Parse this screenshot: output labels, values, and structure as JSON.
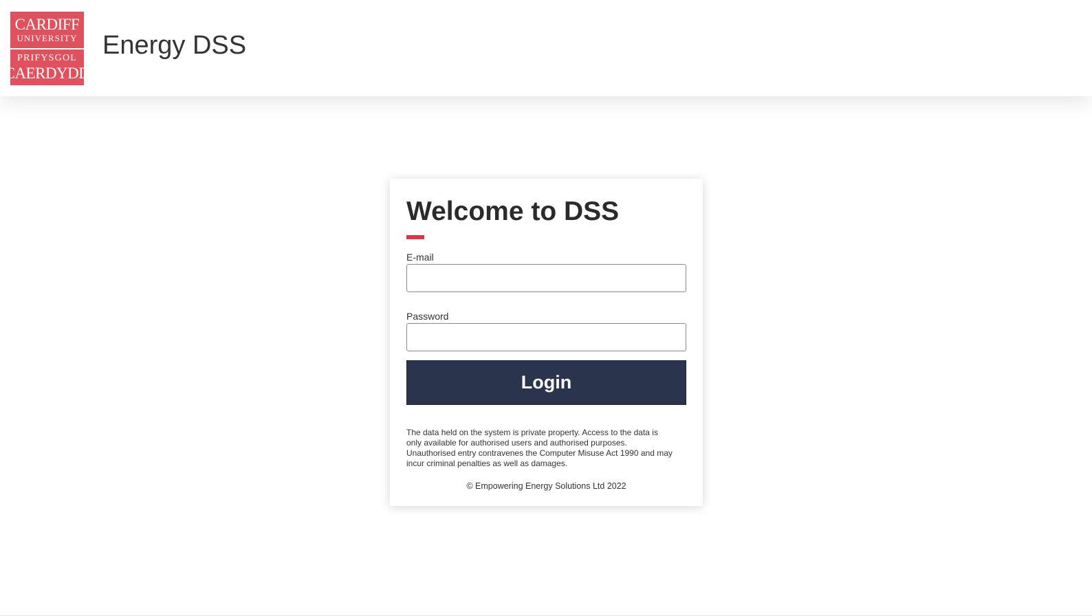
{
  "header": {
    "logo": {
      "top_line1": "CARDIFF",
      "top_line2": "UNIVERSITY",
      "bottom_line1": "PRIFYSGOL",
      "bottom_line2": "CAERDYDD"
    },
    "app_title": "Energy DSS"
  },
  "login_card": {
    "title": "Welcome to DSS",
    "accent_color": "#d4374a",
    "email": {
      "label": "E-mail",
      "value": "",
      "placeholder": ""
    },
    "password": {
      "label": "Password",
      "value": "",
      "placeholder": ""
    },
    "login_button": {
      "label": "Login",
      "color": "#2b344d"
    },
    "disclaimer": "The data held on the system is private property. Access to the data is only available for authorised users and authorised purposes. Unauthorised entry contravenes the Computer Misuse Act 1990 and may incur criminal penalties as well as damages.",
    "copyright": "© Empowering Energy Solutions Ltd 2022"
  },
  "colors": {
    "logo_red": "#e0515d",
    "navy": "#2b344d"
  }
}
